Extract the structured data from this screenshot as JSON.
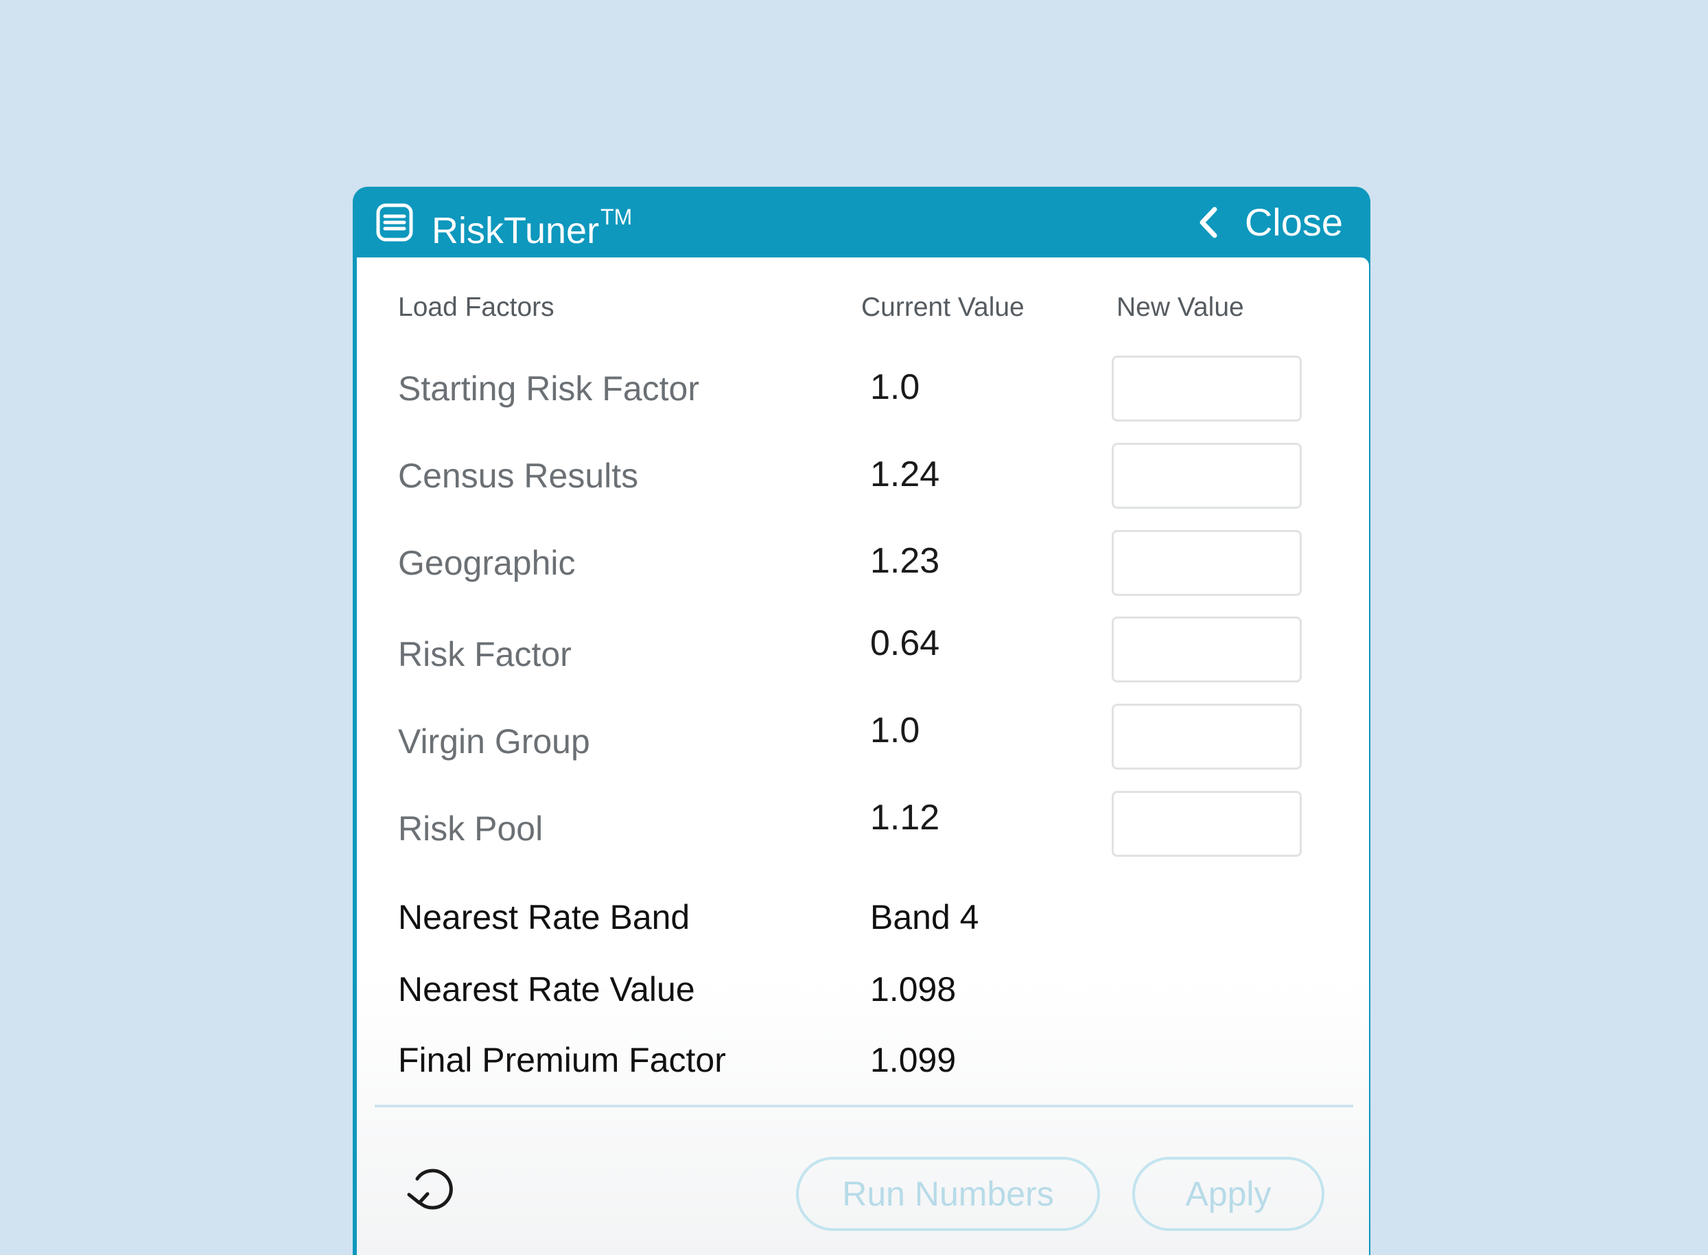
{
  "header": {
    "title": "RiskTuner",
    "trademark": "TM",
    "close_label": "Close",
    "app_icon": "list-icon",
    "close_icon": "chevron-left-icon",
    "bar_color": "#0e98bd"
  },
  "table": {
    "columns": {
      "factor": "Load Factors",
      "current": "Current Value",
      "new": "New Value"
    },
    "rows": [
      {
        "label": "Starting  Risk Factor",
        "value": "1.0",
        "new_value": ""
      },
      {
        "label": "Census  Results",
        "value": "1.24",
        "new_value": ""
      },
      {
        "label": "Geographic",
        "value": "1.23",
        "new_value": ""
      },
      {
        "label": "Risk Factor",
        "value": "0.64",
        "new_value": ""
      },
      {
        "label": "Virgin Group",
        "value": "1.0",
        "new_value": ""
      },
      {
        "label": "Risk Pool",
        "value": "1.12",
        "new_value": ""
      }
    ]
  },
  "summary": [
    {
      "label": "Nearest Rate Band",
      "value": "Band 4"
    },
    {
      "label": "Nearest Rate Value",
      "value": "1.098"
    },
    {
      "label": "Final Premium Factor",
      "value": "1.099"
    }
  ],
  "footer": {
    "reset_icon": "reset-icon",
    "run_label": "Run Numbers",
    "apply_label": "Apply"
  },
  "colors": {
    "background": "#d1e2f0",
    "accent": "#0e98bd",
    "disabled_button": "#b7dbe8"
  }
}
